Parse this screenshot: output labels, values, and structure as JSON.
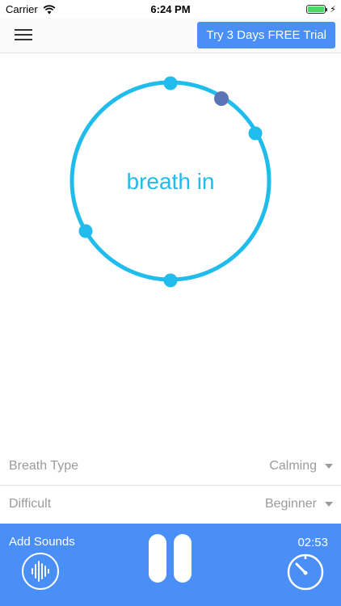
{
  "status_bar": {
    "carrier": "Carrier",
    "time": "6:24 PM"
  },
  "nav": {
    "trial_button_label": "Try 3 Days FREE Trial"
  },
  "breath": {
    "instruction": "breath in",
    "ring_color": "#1fbcec",
    "active_dot_color": "#5b74b8"
  },
  "settings": {
    "breath_type_label": "Breath Type",
    "breath_type_value": "Calming",
    "difficulty_label": "Difficult",
    "difficulty_value": "Beginner"
  },
  "bottom_bar": {
    "add_sounds_label": "Add Sounds",
    "timer_value": "02:53",
    "background_color": "#4a8ef8"
  },
  "icons": {
    "menu": "hamburger-menu-icon",
    "sounds": "sound-wave-icon",
    "pause": "pause-icon",
    "timer": "stopwatch-icon"
  }
}
